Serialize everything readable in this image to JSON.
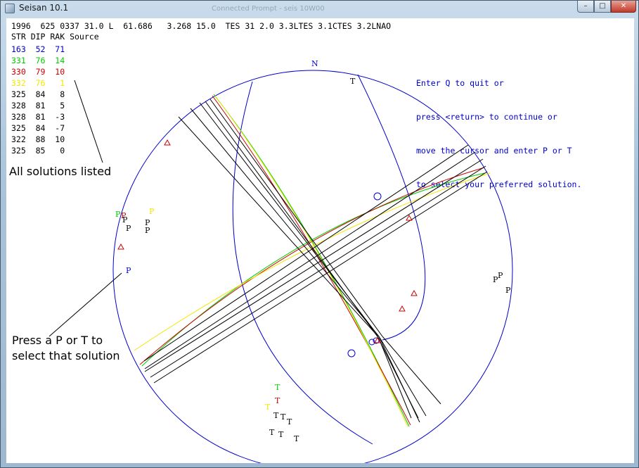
{
  "window": {
    "title": "Seisan 10.1",
    "background_title": "Connected Prompt - seis 10W00",
    "controls": {
      "minimize": "–",
      "maximize": "□",
      "close": "✕"
    }
  },
  "header_line": "1996  625 0337 31.0 L  61.686   3.268 15.0  TES 31 2.0 3.3LTES 3.1CTES 3.2LNAO",
  "columns": "STR DIP RAK Source",
  "solutions": [
    {
      "text": "163  52  71",
      "color": "#0000cc"
    },
    {
      "text": "331  76  14",
      "color": "#00cc00"
    },
    {
      "text": "330  79  10",
      "color": "#cc0000"
    },
    {
      "text": "332  76   1",
      "color": "#f2e600"
    },
    {
      "text": "325  84   8",
      "color": "#000000"
    },
    {
      "text": "328  81   5",
      "color": "#000000"
    },
    {
      "text": "328  81  -3",
      "color": "#000000"
    },
    {
      "text": "325  84  -7",
      "color": "#000000"
    },
    {
      "text": "322  88  10",
      "color": "#000000"
    },
    {
      "text": "325  85   0",
      "color": "#000000"
    }
  ],
  "annotations": {
    "all_solutions": "All solutions listed",
    "press_line1": "Press a P or T to",
    "press_line2": "select that solution"
  },
  "instructions": [
    "Enter Q to quit or",
    "press <return> to continue or",
    "move the cursor and enter P or T",
    "to select your preferred solution."
  ],
  "plot": {
    "north_label": "N",
    "p_label": "P",
    "t_label": "T",
    "colors": {
      "blue": "#0000cc",
      "green": "#00cc00",
      "red": "#cc0000",
      "yellow": "#f2e600",
      "black": "#000000"
    }
  }
}
